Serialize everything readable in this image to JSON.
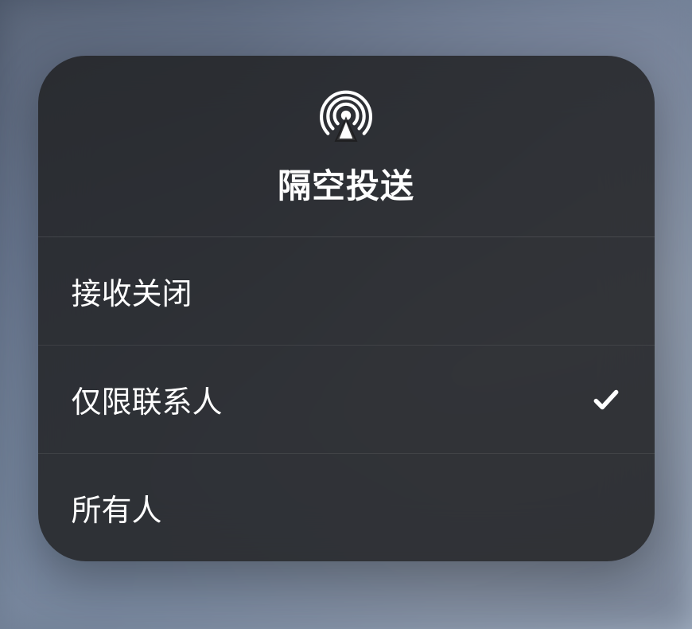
{
  "header": {
    "title": "隔空投送",
    "icon_name": "airdrop-icon"
  },
  "options": [
    {
      "label": "接收关闭",
      "selected": false
    },
    {
      "label": "仅限联系人",
      "selected": true
    },
    {
      "label": "所有人",
      "selected": false
    }
  ]
}
